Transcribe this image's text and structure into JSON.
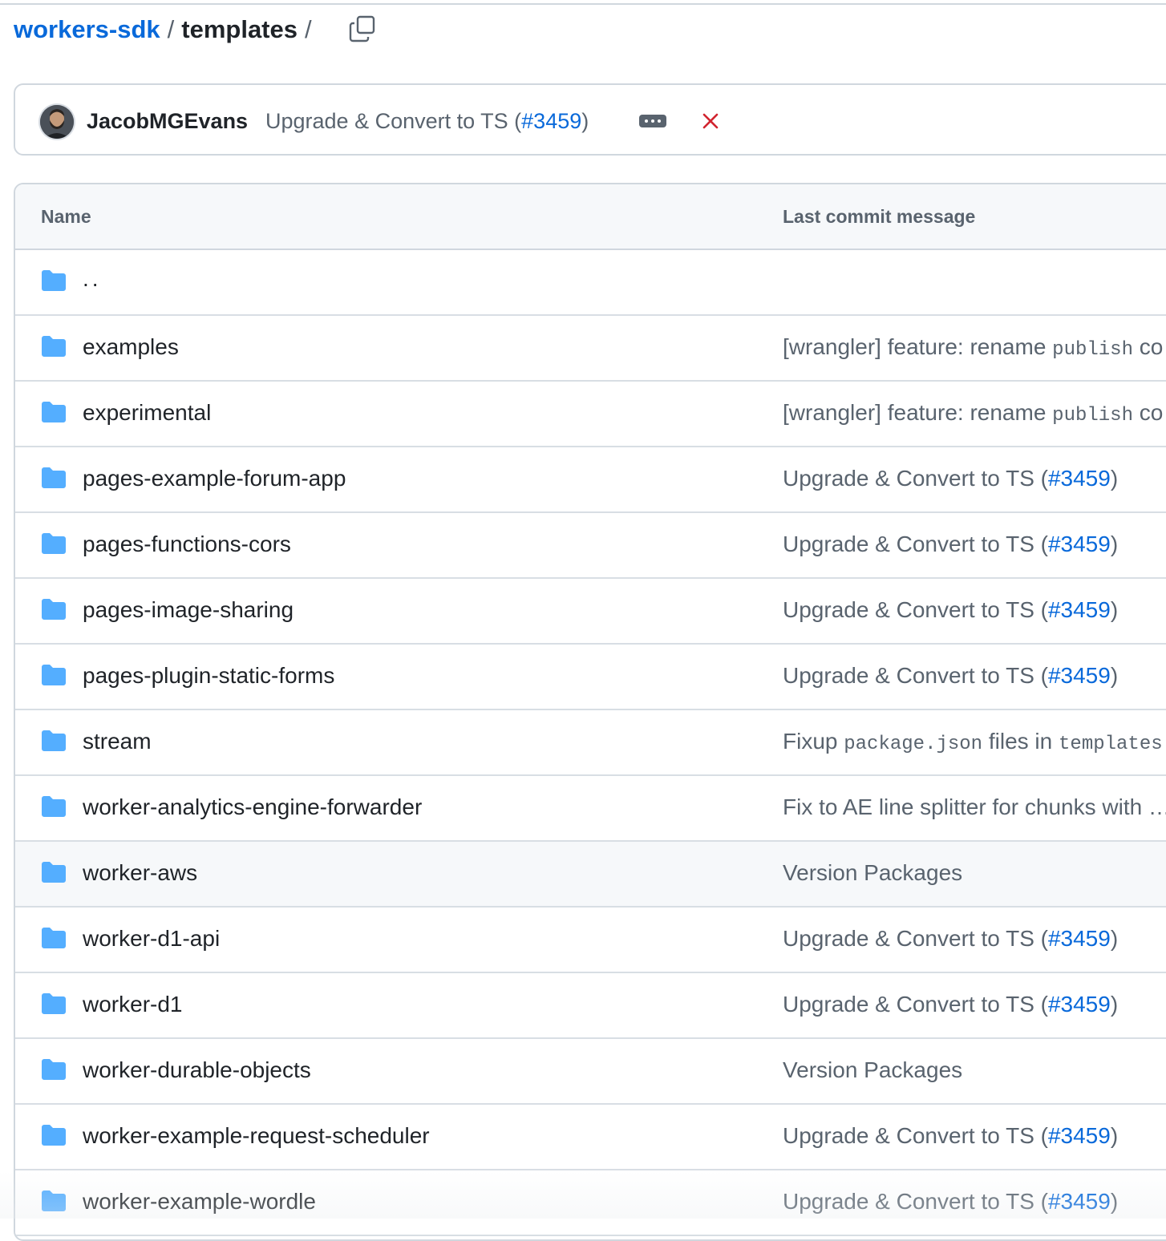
{
  "breadcrumb": {
    "repo": "workers-sdk",
    "separator": "/",
    "directory": "templates",
    "trailing_separator": "/"
  },
  "icons": {
    "copy": "copy-icon",
    "folder": "folder-icon",
    "ellipsis": "ellipsis-icon",
    "status_failure": "x-icon"
  },
  "colors": {
    "link": "#0969da",
    "folder": "#54aeff",
    "failure": "#d1242f",
    "muted": "#59636e"
  },
  "latest_commit": {
    "author": "JacobMGEvans",
    "message_prefix": "Upgrade & Convert to TS (",
    "pr": "#3459",
    "message_suffix": ")"
  },
  "table": {
    "headers": {
      "name": "Name",
      "last_commit": "Last commit message"
    },
    "parent": "..",
    "rows": [
      {
        "name": "examples",
        "msg": "[wrangler] feature: rename ",
        "code": "publish",
        "msg2": " co"
      },
      {
        "name": "experimental",
        "msg": "[wrangler] feature: rename ",
        "code": "publish",
        "msg2": " co"
      },
      {
        "name": "pages-example-forum-app",
        "msg": "Upgrade & Convert to TS (",
        "pr": "#3459",
        "msg2": ")"
      },
      {
        "name": "pages-functions-cors",
        "msg": "Upgrade & Convert to TS (",
        "pr": "#3459",
        "msg2": ")"
      },
      {
        "name": "pages-image-sharing",
        "msg": "Upgrade & Convert to TS (",
        "pr": "#3459",
        "msg2": ")"
      },
      {
        "name": "pages-plugin-static-forms",
        "msg": "Upgrade & Convert to TS (",
        "pr": "#3459",
        "msg2": ")"
      },
      {
        "name": "stream",
        "msg": "Fixup ",
        "code": "package.json",
        "msg2": " files in ",
        "code2": "templates"
      },
      {
        "name": "worker-analytics-engine-forwarder",
        "msg": "Fix to AE line splitter for chunks with …"
      },
      {
        "name": "worker-aws",
        "msg": "Version Packages",
        "hover": true
      },
      {
        "name": "worker-d1-api",
        "msg": "Upgrade & Convert to TS (",
        "pr": "#3459",
        "msg2": ")"
      },
      {
        "name": "worker-d1",
        "msg": "Upgrade & Convert to TS (",
        "pr": "#3459",
        "msg2": ")"
      },
      {
        "name": "worker-durable-objects",
        "msg": "Version Packages"
      },
      {
        "name": "worker-example-request-scheduler",
        "msg": "Upgrade & Convert to TS (",
        "pr": "#3459",
        "msg2": ")"
      },
      {
        "name": "worker-example-wordle",
        "msg": "Upgrade & Convert to TS (",
        "pr": "#3459",
        "msg2": ")"
      }
    ]
  }
}
